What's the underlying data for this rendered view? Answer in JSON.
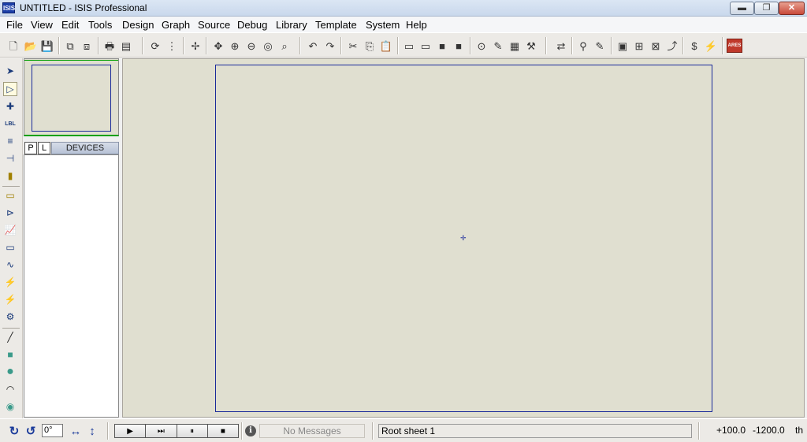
{
  "window": {
    "icon": "ISIS",
    "title": "UNTITLED - ISIS Professional",
    "min_glyph": "▬",
    "max_glyph": "❐",
    "close_glyph": "✕"
  },
  "menu": [
    "File",
    "View",
    "Edit",
    "Tools",
    "Design",
    "Graph",
    "Source",
    "Debug",
    "Library",
    "Template",
    "System",
    "Help"
  ],
  "toolbar_icons": {
    "new": "🗋",
    "open": "📂",
    "save": "💾",
    "import-section": "⧉",
    "export-section": "⧈",
    "print": "🖶",
    "print-area": "▤",
    "redraw": "⟳",
    "grid": "⋮",
    "false-origin": "✢",
    "pan": "✥",
    "zoom-in": "⊕",
    "zoom-out": "⊖",
    "zoom-all": "◎",
    "zoom-area": "⌕",
    "undo": "↶",
    "redo": "↷",
    "cut": "✂",
    "copy": "⎘",
    "paste": "📋",
    "block-copy": "▭",
    "block-move": "▭",
    "block-rotate": "■",
    "block-delete": "■",
    "pick-device": "⊙",
    "make-device": "✎",
    "packaging": "▦",
    "decompose": "⚒",
    "wire-autorouter": "⇄",
    "search": "⚲",
    "property-assignment": "✎",
    "new-sheet": "▣",
    "remove-sheet": "⊠",
    "goto-sheet": "⊞",
    "parent": "⤴",
    "bill-of-materials": "$",
    "electrical-rules": "⚡",
    "netlist-ares": "ARES"
  },
  "palette_icons": {
    "selection": "➤",
    "component": "▷",
    "junction": "✚",
    "wire-label": "LBL",
    "text-script": "≡",
    "buses": "⊣",
    "subcircuit": "▮",
    "terminals": "▭",
    "device-pins": "⊳",
    "graph": "📈",
    "tape-recorder": "▭",
    "generator": "∿",
    "voltage-probe": "⚡",
    "current-probe": "⚡",
    "virtual-instruments": "⚙",
    "line": "╱",
    "box": "■",
    "circle": "●",
    "arc": "◠",
    "path": "◉"
  },
  "devices": {
    "p_label": "P",
    "l_label": "L",
    "title": "DEVICES"
  },
  "status": {
    "rotate_cw": "↻",
    "rotate_ccw": "↺",
    "angle": "0°",
    "mirror_x": "↔",
    "mirror_y": "↕",
    "sim": [
      "▶",
      "⏭",
      "⏸",
      "■"
    ],
    "info": "i",
    "messages": "No Messages",
    "sheet": "Root sheet 1",
    "x": "+100.0",
    "y": "-1200.0",
    "units": "th"
  },
  "canvas": {
    "origin_glyph": "✛"
  }
}
